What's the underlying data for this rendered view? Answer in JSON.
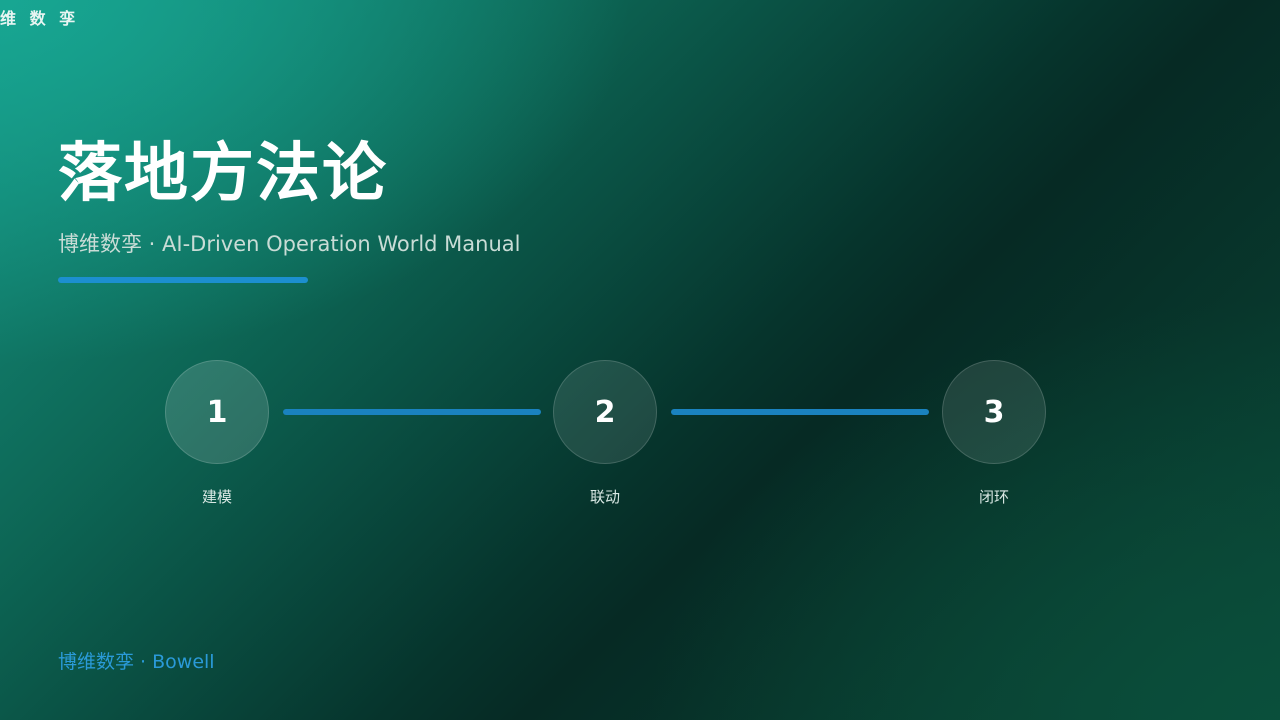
{
  "header": {
    "logo_text": "维 数 孪"
  },
  "slide": {
    "title": "落地方法论",
    "subtitle": "博维数孪 · AI-Driven Operation World Manual"
  },
  "steps": [
    {
      "number": "1",
      "label": "建模"
    },
    {
      "number": "2",
      "label": "联动"
    },
    {
      "number": "3",
      "label": "闭环"
    }
  ],
  "footer": {
    "text": "博维数孪 · Bowell"
  },
  "colors": {
    "accent": "#1c8fcf",
    "footer_text": "#2a9ad8",
    "background_light": "#15917f",
    "background_dark": "#062a24"
  }
}
